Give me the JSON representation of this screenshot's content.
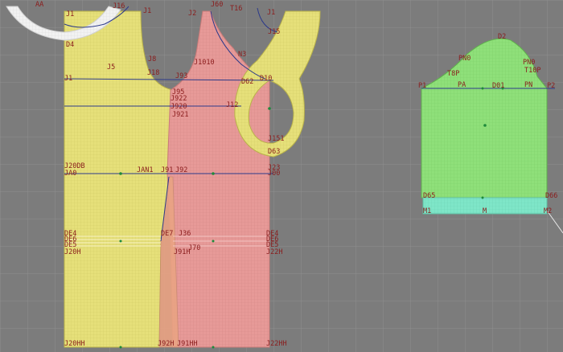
{
  "colors": {
    "background": "#7c7c7c",
    "grid": "#8e8e8e",
    "front_bodice_fill": "#e6e07a",
    "back_bodice_fill": "#e79a98",
    "sleeve_fill": "#8fe07a",
    "cuff_fill": "#7fe6c8",
    "collar_fill": "#f0f0f0",
    "outline_dark": "#2c3a8a",
    "label_color": "#8a1c1c",
    "point_green": "#1e8a3a"
  },
  "pieces": {
    "front_bodice": "front-bodice",
    "back_bodice": "back-bodice",
    "armhole_facing": "armhole-facing",
    "sleeve": "sleeve",
    "cuff": "cuff",
    "collar": "collar"
  },
  "labels": {
    "aa": "AA",
    "j1a": "J1",
    "j16": "J16",
    "j2": "J2",
    "j60": "J60",
    "t16": "T16",
    "j1b": "J1",
    "j15": "J15",
    "r": "R",
    "d4": "D4",
    "j5": "J5",
    "j8": "J8",
    "j1010": "J1010",
    "n3": "N3",
    "j1c": "J1",
    "j18": "J18",
    "j93": "J93",
    "d62": "D62",
    "d10": "D10",
    "j95": "J95",
    "j922": "J922",
    "j920": "J920",
    "j921": "J921",
    "j12": "J12",
    "j151": "J151",
    "d63": "D63",
    "j20db": "J20DB",
    "ja0": "JA0",
    "jan1": "JAN1",
    "j91": "J91",
    "j92": "J92",
    "j23": "J23",
    "j00": "J00",
    "de4": "DE4",
    "de6": "DE6",
    "de5": "DE5",
    "de7": "DE7",
    "j20h": "J20H",
    "j36": "J36",
    "j91h": "J91H",
    "j70": "J70",
    "j22h": "J22H",
    "j20hh": "J20HH",
    "j92h": "J92H",
    "j91hh": "J91HH",
    "j22hh": "J22HH",
    "d2": "D2",
    "pn0a": "PN0",
    "pn0b": "PN0",
    "t8p": "T8P",
    "t10p": "T10P",
    "p1": "P1",
    "pn": "PN",
    "pa": "PA",
    "p2": "P2",
    "d01": "D01",
    "d65": "D65",
    "d66": "D66",
    "m1": "M1",
    "m": "M",
    "m2": "M2"
  }
}
